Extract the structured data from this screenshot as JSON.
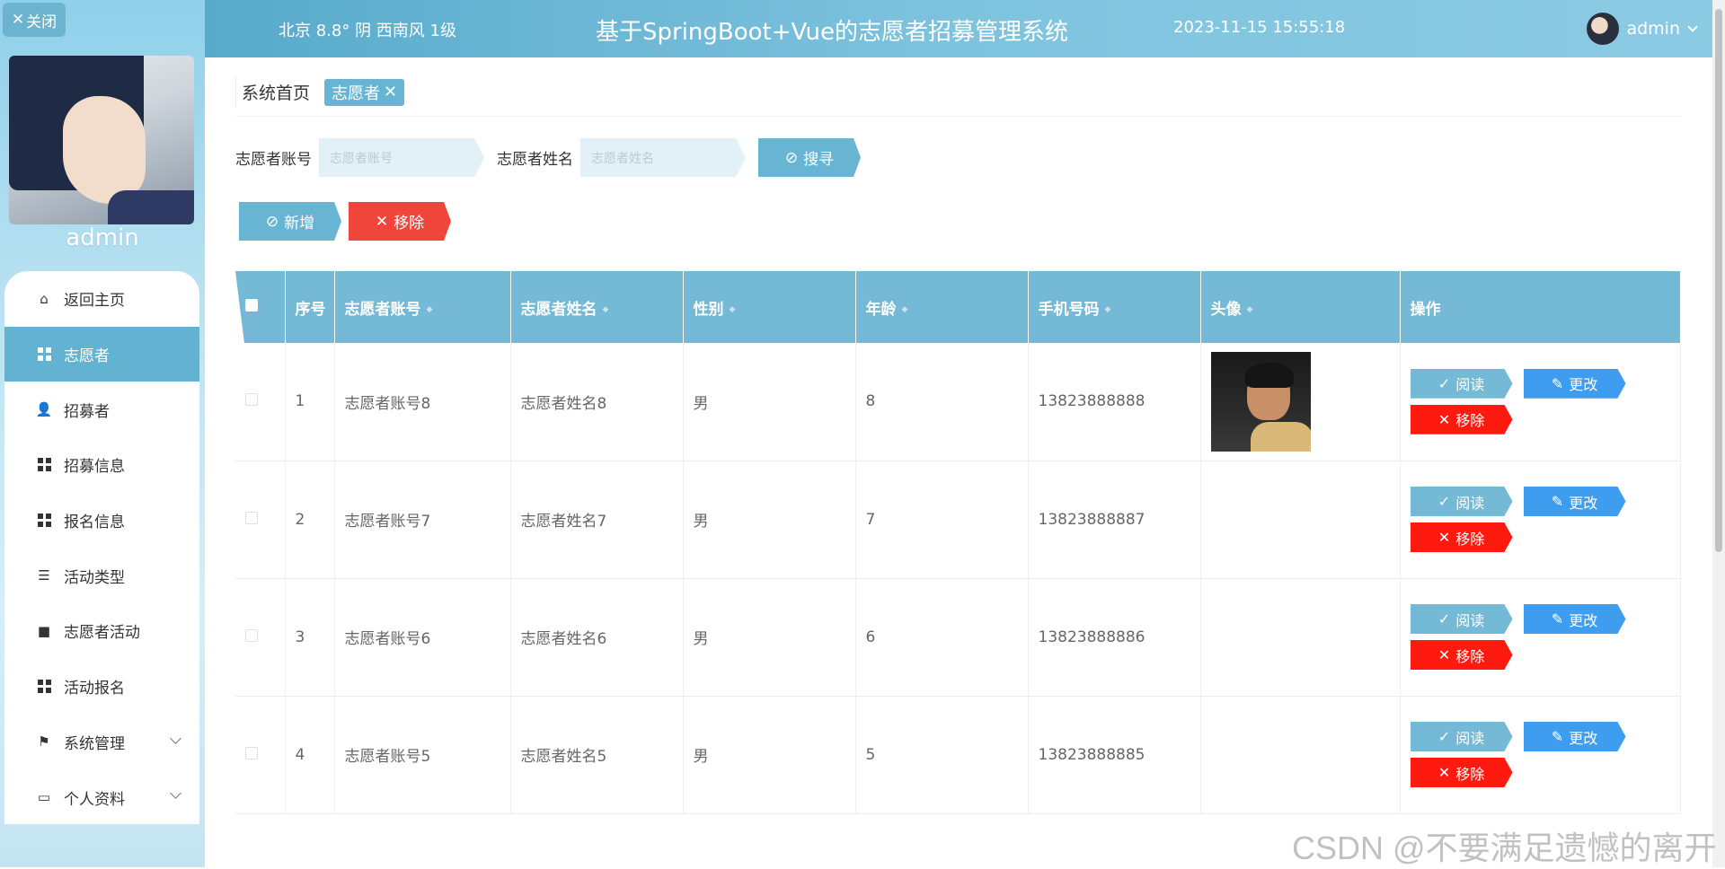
{
  "sidebar": {
    "close_label": "关闭",
    "username": "admin",
    "items": [
      {
        "label": "返回主页",
        "icon": "home-icon"
      },
      {
        "label": "志愿者",
        "icon": "grid-icon",
        "active": true
      },
      {
        "label": "招募者",
        "icon": "user-icon"
      },
      {
        "label": "招募信息",
        "icon": "grid-icon"
      },
      {
        "label": "报名信息",
        "icon": "grid-icon"
      },
      {
        "label": "活动类型",
        "icon": "sliders-icon"
      },
      {
        "label": "志愿者活动",
        "icon": "briefcase-icon"
      },
      {
        "label": "活动报名",
        "icon": "grid-icon"
      },
      {
        "label": "系统管理",
        "icon": "flag-icon",
        "expandable": true
      },
      {
        "label": "个人资料",
        "icon": "card-icon",
        "expandable": true
      }
    ]
  },
  "header": {
    "weather": "北京  8.8°  阴  西南风  1级",
    "title": "基于SpringBoot+Vue的志愿者招募管理系统",
    "datetime": "2023-11-15 15:55:18",
    "user": "admin"
  },
  "breadcrumb": {
    "home": "系统首页",
    "current": "志愿者"
  },
  "search": {
    "account_label": "志愿者账号",
    "account_placeholder": "志愿者账号",
    "name_label": "志愿者姓名",
    "name_placeholder": "志愿者姓名",
    "search_button": "搜寻"
  },
  "actions": {
    "add": "新增",
    "remove": "移除"
  },
  "table": {
    "columns": [
      "序号",
      "志愿者账号",
      "志愿者姓名",
      "性别",
      "年龄",
      "手机号码",
      "头像",
      "操作"
    ],
    "rows": [
      {
        "no": "1",
        "account": "志愿者账号8",
        "name": "志愿者姓名8",
        "gender": "男",
        "age": "8",
        "phone": "13823888888",
        "has_avatar": true
      },
      {
        "no": "2",
        "account": "志愿者账号7",
        "name": "志愿者姓名7",
        "gender": "男",
        "age": "7",
        "phone": "13823888887",
        "has_avatar": false
      },
      {
        "no": "3",
        "account": "志愿者账号6",
        "name": "志愿者姓名6",
        "gender": "男",
        "age": "6",
        "phone": "13823888886",
        "has_avatar": false
      },
      {
        "no": "4",
        "account": "志愿者账号5",
        "name": "志愿者姓名5",
        "gender": "男",
        "age": "5",
        "phone": "13823888885",
        "has_avatar": false
      }
    ],
    "row_actions": {
      "read": "阅读",
      "edit": "更改",
      "delete": "移除"
    }
  },
  "watermark": "CSDN @不要满足遗憾的离开",
  "colors": {
    "accent": "#67b4d3",
    "danger": "#ff1a10",
    "edit": "#3f9df0"
  }
}
